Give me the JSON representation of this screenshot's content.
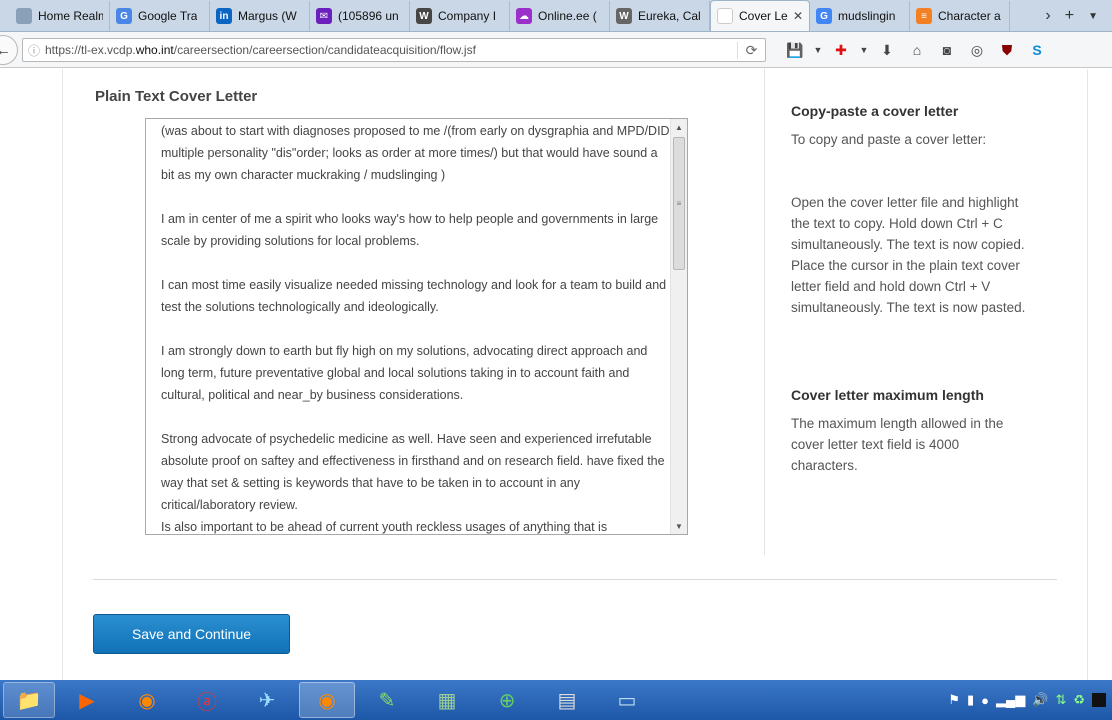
{
  "browser": {
    "tabs": [
      {
        "title": "Home Realm D",
        "icon": "generic-page-icon",
        "fav": "",
        "color": "#8aa0b8"
      },
      {
        "title": "Google Tra",
        "icon": "google-translate-icon",
        "fav": "G",
        "color": "#4a86e8"
      },
      {
        "title": "Margus (W",
        "icon": "linkedin-icon",
        "fav": "in",
        "color": "#0a66c2"
      },
      {
        "title": "(105896 un",
        "icon": "yahoo-mail-icon",
        "fav": "✉",
        "color": "#6b1fbd"
      },
      {
        "title": "Company I",
        "icon": "wordpress-icon",
        "fav": "W",
        "color": "#464646"
      },
      {
        "title": "Online.ee (",
        "icon": "cloud-icon",
        "fav": "☁",
        "color": "#9b2fc9"
      },
      {
        "title": "Eureka, Cal",
        "icon": "wikipedia-icon",
        "fav": "W",
        "color": "#666666"
      },
      {
        "title": "Cover Le",
        "icon": "blank-page-icon",
        "fav": "",
        "color": "#ffffff",
        "active": true
      },
      {
        "title": "mudslingin",
        "icon": "google-icon",
        "fav": "G",
        "color": "#4285f4"
      },
      {
        "title": "Character a",
        "icon": "stack-exchange-icon",
        "fav": "≡",
        "color": "#f48024"
      }
    ],
    "url_prefix": "https://tl-ex.vcdp.",
    "url_domain": "who.int",
    "url_path": "/careersection/careersection/candidateacquisition/flow.jsf"
  },
  "page": {
    "section_title": "Plain Text Cover Letter",
    "cover_letter_paragraphs": [
      "(was about to start with  diagnoses  proposed to me /(from early on dysgraphia and MPD/DID multiple personality \"dis\"order; looks as order at more times/) but that would have sound a bit as my own character muckraking / mudslinging )",
      "I am in center of me a spirit who looks way's how to help people and governments in large scale by providing solutions for local problems.",
      "I can most time easily visualize needed missing technology and look for a team to build  and test the solutions technologically and ideologically.",
      "I am strongly down to earth but fly high on my solutions, advocating direct approach and long term, future preventative global and local solutions taking in to account faith and cultural, political and near_by business considerations.",
      "Strong advocate of psychedelic medicine as well. Have seen and experienced irrefutable absolute proof on saftey and effectiveness in firsthand  and on research field. have fixed the way that set & setting is keywords that have to be taken in to account in any critical/laboratory review.",
      "Is also important to be ahead of current youth reckless usages of anything that is"
    ],
    "help": {
      "copy_paste_title": "Copy-paste a cover letter",
      "copy_paste_intro": "To copy and paste a cover letter:",
      "copy_paste_steps": "Open the cover letter file and highlight the text to copy. Hold down Ctrl + C simultaneously. The text is now copied. Place the cursor in the plain text cover letter field and hold down Ctrl + V simultaneously. The text is now pasted.",
      "max_length_title": "Cover letter maximum length",
      "max_length_text": "The maximum length allowed in the cover letter text field is 4000 characters."
    },
    "save_button_label": "Save and Continue"
  }
}
